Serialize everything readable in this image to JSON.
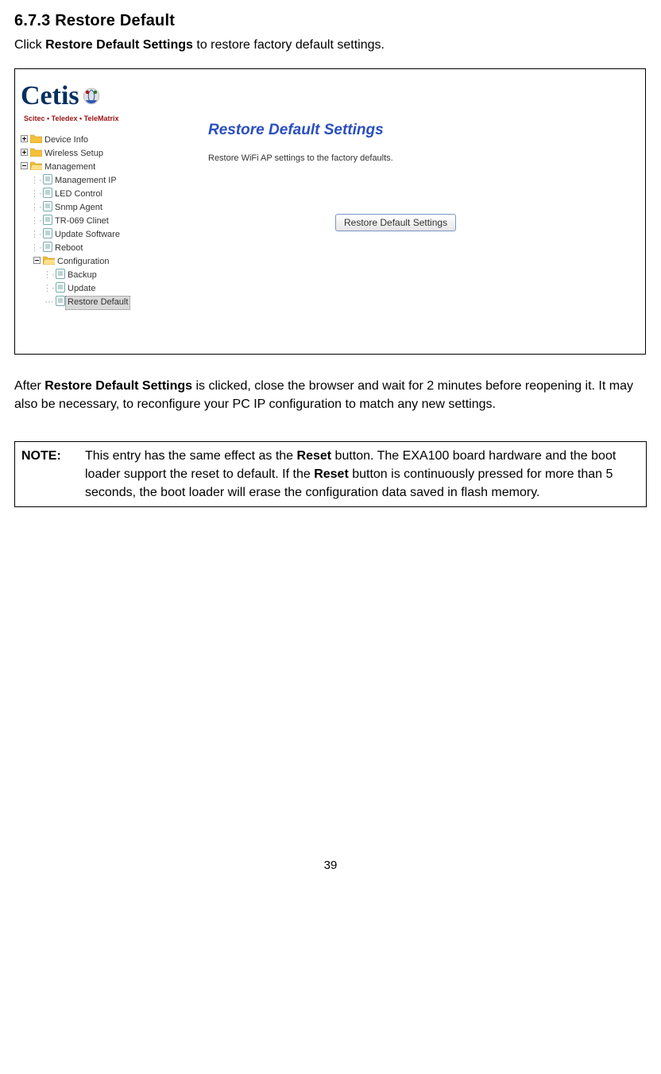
{
  "section": {
    "number": "6.7.3",
    "title": "Restore Default"
  },
  "instruction_prefix": "Click ",
  "instruction_bold": "Restore Default Settings",
  "instruction_suffix": " to restore factory default settings.",
  "logo": {
    "text": "Cetis",
    "sub": "Scitec • Teledex • TeleMatrix"
  },
  "tree": {
    "device_info": "Device Info",
    "wireless_setup": "Wireless Setup",
    "management": "Management",
    "management_ip": "Management IP",
    "led_control": "LED Control",
    "snmp_agent": "Snmp Agent",
    "tr069": "TR-069 Clinet",
    "update_software": "Update Software",
    "reboot": "Reboot",
    "configuration": "Configuration",
    "backup": "Backup",
    "update": "Update",
    "restore_default": "Restore Default"
  },
  "panel": {
    "title": "Restore Default Settings",
    "desc": "Restore WiFi AP settings to the factory defaults.",
    "button": "Restore Default Settings"
  },
  "after_para_prefix": "After ",
  "after_para_bold": "Restore Default Settings",
  "after_para_suffix": " is clicked, close the browser and wait for 2 minutes before reopening it. It may also be necessary, to reconfigure your PC IP configuration to match any new settings.",
  "note": {
    "label": "NOTE:",
    "body_p1": "This entry has the same effect as the ",
    "body_b1": "Reset",
    "body_p2": " button. The EXA100 board hardware and the boot loader support the reset to default. If the ",
    "body_b2": "Reset",
    "body_p3": " button is continuously pressed for more than 5 seconds, the boot loader will erase the configuration data saved in flash memory."
  },
  "page_number": "39"
}
